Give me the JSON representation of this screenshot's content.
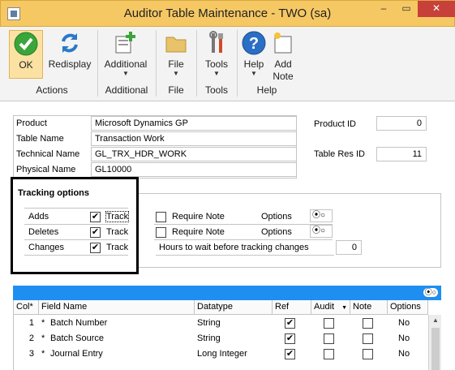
{
  "window": {
    "title": "Auditor Table Maintenance  -  TWO (sa)",
    "min": "–",
    "max": "▭",
    "close": "✕"
  },
  "ribbon": {
    "ok": "OK",
    "redisplay": "Redisplay",
    "additional": "Additional",
    "file": "File",
    "tools": "Tools",
    "help": "Help",
    "add_note": "Add Note",
    "arrow": "▼",
    "groups": {
      "actions": "Actions",
      "additional": "Additional",
      "file": "File",
      "tools": "Tools",
      "help": "Help"
    }
  },
  "fields": {
    "product_label": "Product",
    "product_value": "Microsoft Dynamics GP",
    "table_name_label": "Table Name",
    "table_name_value": "Transaction Work",
    "technical_name_label": "Technical Name",
    "technical_name_value": "GL_TRX_HDR_WORK",
    "physical_name_label": "Physical Name",
    "physical_name_value": "GL10000",
    "product_id_label": "Product ID",
    "product_id_value": "0",
    "table_res_id_label": "Table Res ID",
    "table_res_id_value": "11"
  },
  "tracking": {
    "heading": "Tracking options",
    "rows": [
      {
        "label": "Adds",
        "track_label": "Track",
        "track_checked": true,
        "require_label": "Require Note",
        "require_checked": false,
        "options_label": "Options"
      },
      {
        "label": "Deletes",
        "track_label": "Track",
        "track_checked": true,
        "require_label": "Require Note",
        "require_checked": false,
        "options_label": "Options"
      },
      {
        "label": "Changes",
        "track_label": "Track",
        "track_checked": true
      }
    ],
    "hours_label": "Hours to wait before tracking changes",
    "hours_value": "0",
    "radio_glyph": "⦿○"
  },
  "grid": {
    "radio_glyph": "⦿○",
    "columns": [
      "Col",
      "Field Name",
      "Datatype",
      "Ref",
      "Audit",
      "Note",
      "Options"
    ],
    "sort_marker": "*",
    "rows": [
      {
        "col": "1",
        "star": "*",
        "field": "Batch Number",
        "datatype": "String",
        "ref": true,
        "audit": false,
        "note": false,
        "options": "No"
      },
      {
        "col": "2",
        "star": "*",
        "field": "Batch Source",
        "datatype": "String",
        "ref": true,
        "audit": false,
        "note": false,
        "options": "No"
      },
      {
        "col": "3",
        "star": "*",
        "field": "Journal Entry",
        "datatype": "Long Integer",
        "ref": true,
        "audit": false,
        "note": false,
        "options": "No"
      }
    ]
  },
  "check_glyph": "✔"
}
